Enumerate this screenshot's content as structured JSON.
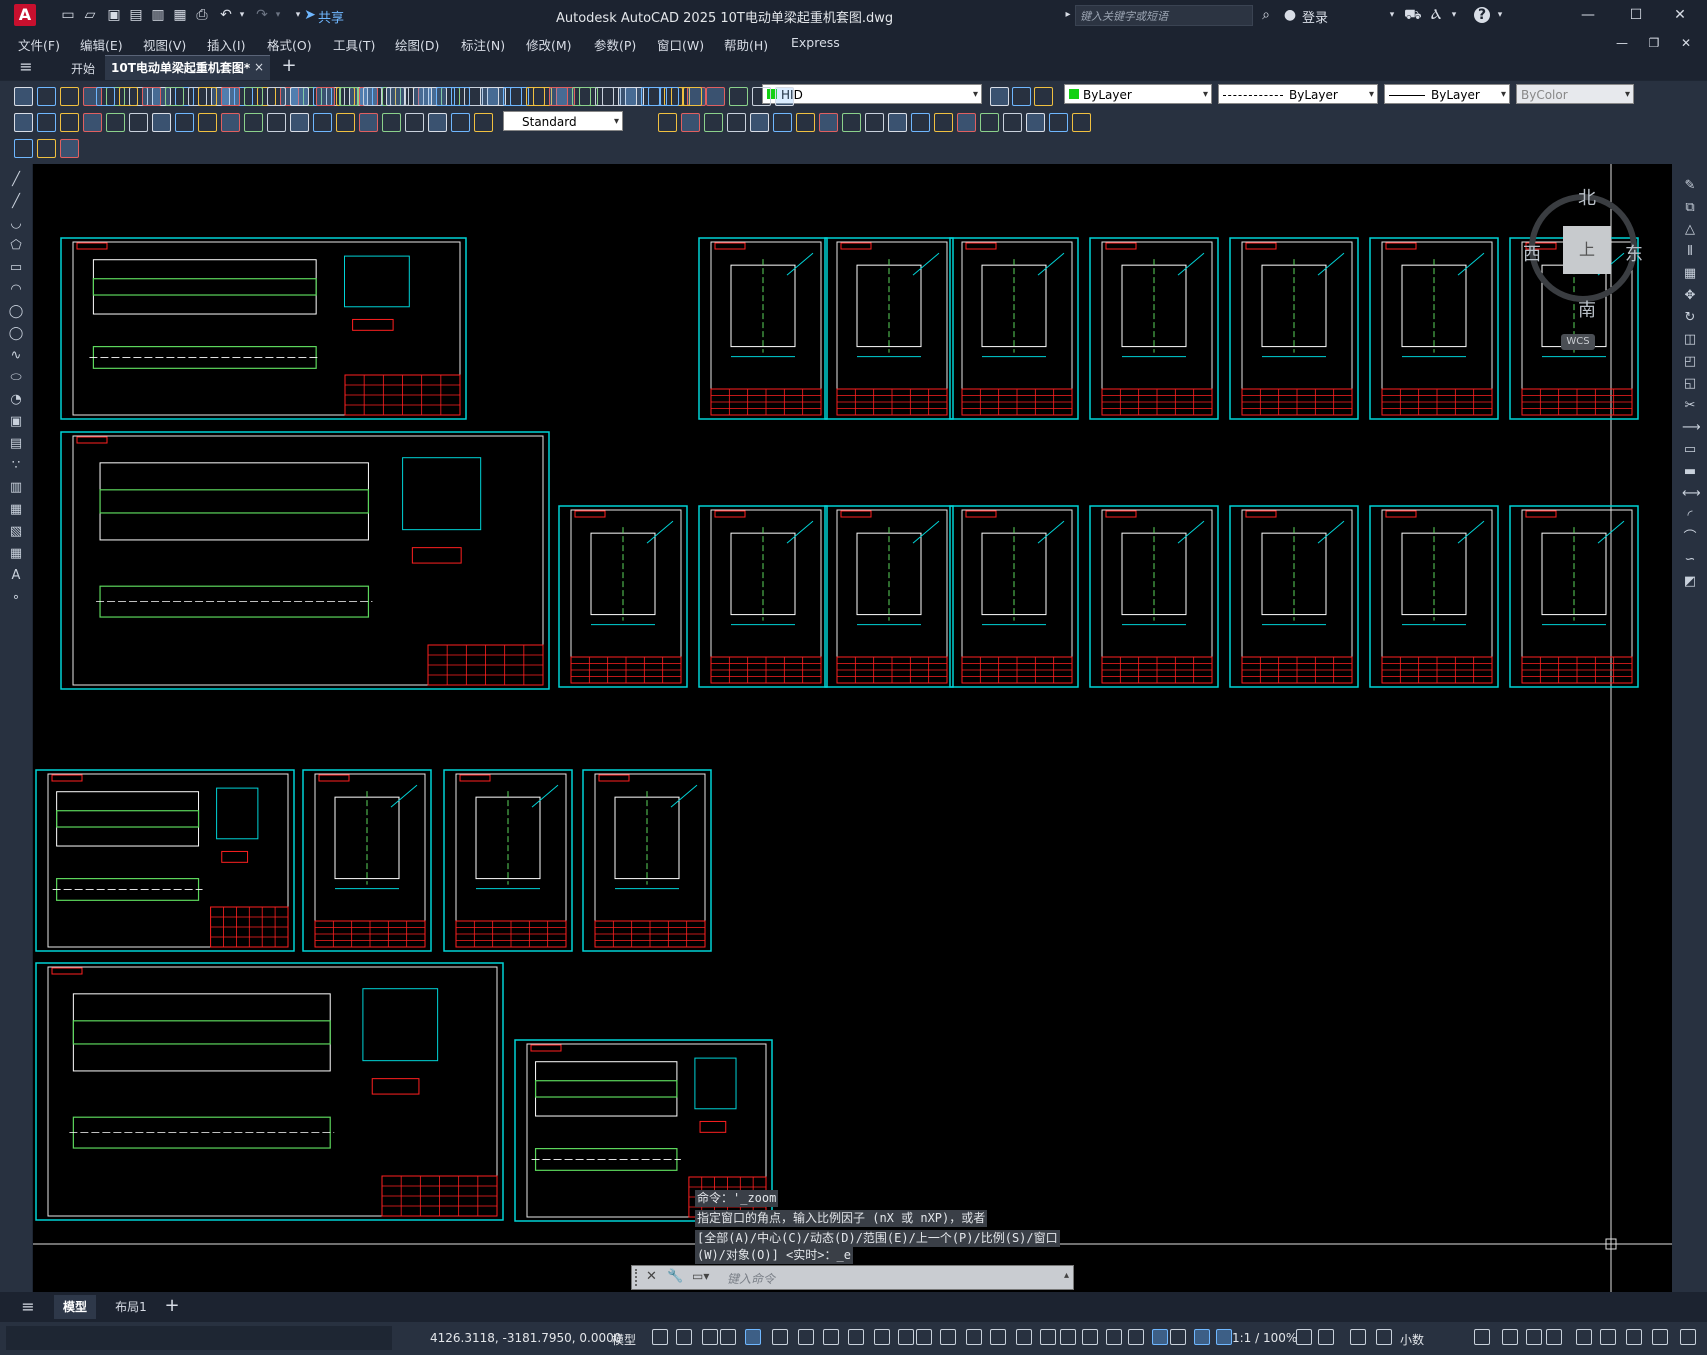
{
  "titlebar": {
    "app_logo": "A",
    "share_label": "共享",
    "window_title": "Autodesk AutoCAD 2025    10T电动单梁起重机套图.dwg",
    "search_placeholder": "键入关键字或短语",
    "login_label": "登录",
    "help_label": "?"
  },
  "menu": {
    "items": [
      "文件(F)",
      "编辑(E)",
      "视图(V)",
      "插入(I)",
      "格式(O)",
      "工具(T)",
      "绘图(D)",
      "标注(N)",
      "修改(M)",
      "参数(P)",
      "窗口(W)",
      "帮助(H)",
      "Express"
    ]
  },
  "tabs": {
    "start": "开始",
    "document": "10T电动单梁起重机套图*",
    "close": "×",
    "add": "+"
  },
  "toolbar": {
    "layer_value": "HID",
    "color_value": "ByLayer",
    "linetype_value": "ByLayer",
    "lineweight_value": "ByLayer",
    "plotstyle_value": "ByColor",
    "textstyle_value": "Standard"
  },
  "viewcube": {
    "north": "北",
    "south": "南",
    "east": "东",
    "west": "西",
    "top_face": "上",
    "wcs": "WCS"
  },
  "command": {
    "history": [
      "命令：'_zoom",
      "指定窗口的角点，输入比例因子 (nX 或 nXP)，或者",
      "[全部(A)/中心(C)/动态(D)/范围(E)/上一个(P)/比例(S)/窗口",
      "(W)/对象(O)] <实时>：_e"
    ],
    "input_placeholder": "键入命令"
  },
  "layout_tabs": {
    "model": "模型",
    "layout1": "布局1",
    "add": "+"
  },
  "status": {
    "coordinates": "4126.3118, -3181.7950, 0.0000",
    "model_label": "模型",
    "scale": "1:1 / 100%",
    "units": "小数"
  },
  "colors": {
    "canvas_bg": "#000000",
    "sheet_frame": "#00d3d6",
    "title_block": "#ff2020",
    "geometry_green": "#5cd65c",
    "ui_dark": "#1c2330",
    "ui_toolbar": "#283140"
  }
}
